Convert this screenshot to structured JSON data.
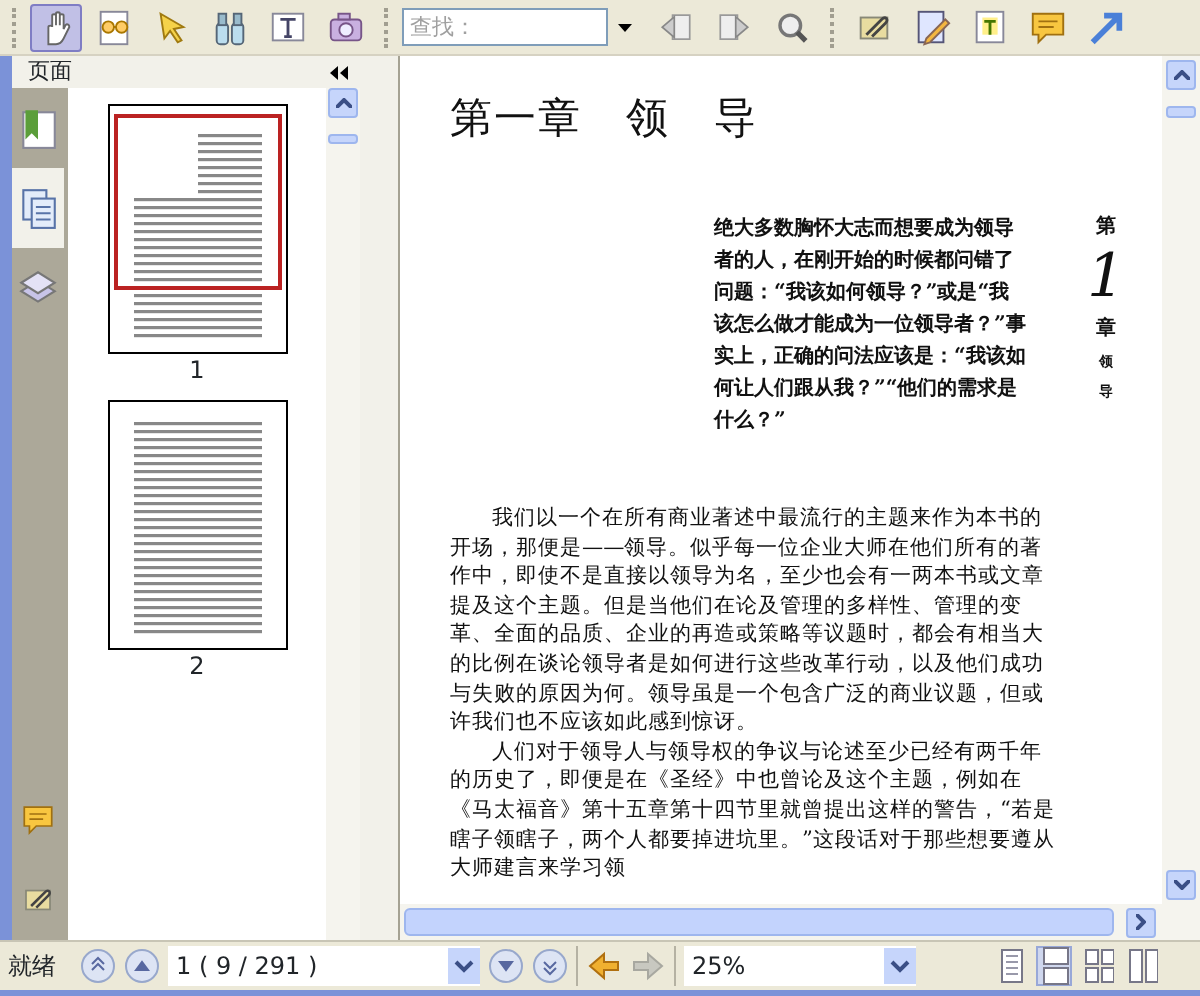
{
  "toolbar": {
    "tools": [
      {
        "kind": "hand",
        "selected": true
      },
      {
        "kind": "reading",
        "selected": false
      },
      {
        "kind": "pointer",
        "selected": false
      },
      {
        "kind": "binoculars",
        "selected": false
      },
      {
        "kind": "textselect",
        "selected": false
      },
      {
        "kind": "camera",
        "selected": false
      }
    ],
    "search": {
      "placeholder": "查找："
    },
    "find_buttons": [
      {
        "kind": "prev"
      },
      {
        "kind": "next"
      },
      {
        "kind": "magnify"
      }
    ],
    "annotate": [
      {
        "kind": "attach"
      },
      {
        "kind": "pencil"
      },
      {
        "kind": "textbox"
      },
      {
        "kind": "comment"
      },
      {
        "kind": "arrow"
      }
    ]
  },
  "sidebar": {
    "title": "页面",
    "tabs": [
      {
        "kind": "bookmarks",
        "selected": false
      },
      {
        "kind": "pages",
        "selected": true
      },
      {
        "kind": "layers",
        "selected": false
      }
    ],
    "bottom_tabs": [
      {
        "kind": "comment"
      },
      {
        "kind": "attach"
      }
    ],
    "thumbnails": [
      {
        "label": "1",
        "selected": true
      },
      {
        "label": "2",
        "selected": false
      }
    ]
  },
  "document": {
    "heading": "第一章　领　导",
    "epigraph": "绝大多数胸怀大志而想要成为领导者的人，在刚开始的时候都问错了问题：“我该如何领导？”或是“我该怎么做才能成为一位领导者？”事实上，正确的问法应该是：“我该如何让人们跟从我？”“他们的需求是什么？”",
    "side_tab": [
      "第",
      "1",
      "章",
      "领",
      "导"
    ],
    "paragraphs": [
      "我们以一个在所有商业著述中最流行的主题来作为本书的开场，那便是——领导。似乎每一位企业大师在他们所有的著作中，即使不是直接以领导为名，至少也会有一两本书或文章提及这个主题。但是当他们在论及管理的多样性、管理的变革、全面的品质、企业的再造或策略等议题时，都会有相当大的比例在谈论领导者是如何进行这些改革行动，以及他们成功与失败的原因为何。领导虽是一个包含广泛的商业议题，但或许我们也不应该如此感到惊讶。",
      "人们对于领导人与领导权的争议与论述至少已经有两千年的历史了，即便是在《圣经》中也曾论及这个主题，例如在《马太福音》第十五章第十四节里就曾提出这样的警告，“若是瞎子领瞎子，两个人都要掉进坑里。”这段话对于那些想要遵从大师建言来学习领"
    ]
  },
  "status_bar": {
    "status": "就绪",
    "page": "1 ( 9 / 291 )",
    "back_enabled": true,
    "forward_enabled": false,
    "zoom": "25%",
    "views": [
      {
        "kind": "single",
        "selected": false
      },
      {
        "kind": "continuous",
        "selected": true
      },
      {
        "kind": "facing",
        "selected": false
      },
      {
        "kind": "facingcont",
        "selected": false
      }
    ]
  }
}
